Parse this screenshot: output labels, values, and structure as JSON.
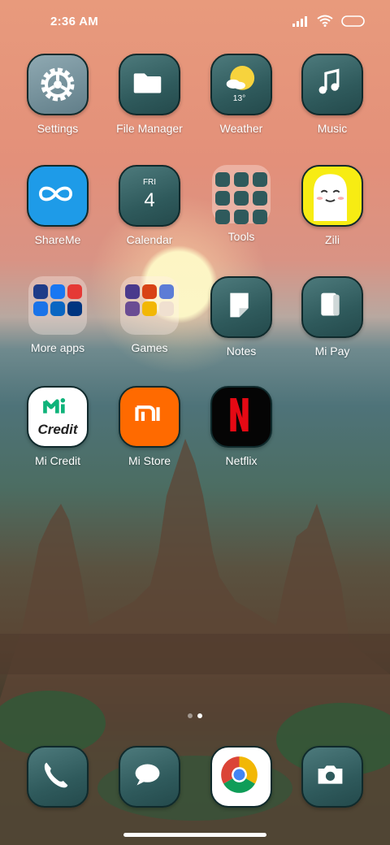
{
  "status_bar": {
    "time": "2:36 AM"
  },
  "apps": {
    "settings": "Settings",
    "file_manager": "File Manager",
    "weather": "Weather",
    "weather_temp": "13°",
    "music": "Music",
    "shareme": "ShareMe",
    "calendar": "Calendar",
    "calendar_day": "FRI",
    "calendar_date": "4",
    "tools": "Tools",
    "zili": "Zili",
    "more_apps": "More apps",
    "games": "Games",
    "notes": "Notes",
    "mi_pay": "Mi Pay",
    "mi_credit": "Mi Credit",
    "mi_credit_logo": "Credit",
    "mi_store": "Mi Store",
    "netflix": "Netflix"
  },
  "page_indicator": {
    "pages": 2,
    "current": 2
  },
  "colors": {
    "shareme": "#1e9be8",
    "mi_store": "#ff6a00",
    "netflix_red": "#e50914",
    "mi_credit_green": "#0fb37a"
  }
}
